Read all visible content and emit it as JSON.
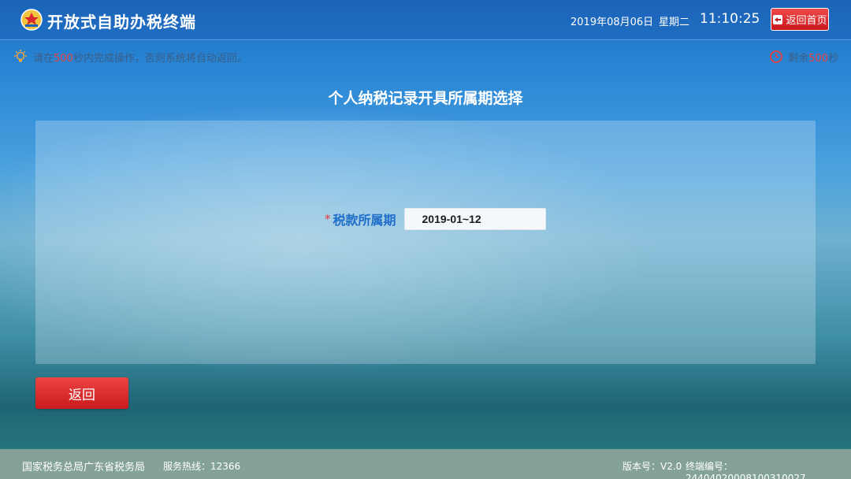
{
  "header": {
    "app_title": "开放式自助办税终端",
    "date": "2019年08月06日",
    "weekday": "星期二",
    "time": "11:10:25",
    "home_label": "返回首页"
  },
  "notice": {
    "prefix": "请在",
    "seconds": "500",
    "suffix": "秒内完成操作，否则系统将自动返回。"
  },
  "timer": {
    "prefix": "剩余",
    "seconds": "500",
    "suffix": "秒"
  },
  "page": {
    "title": "个人纳税记录开具所属期选择"
  },
  "form": {
    "required_mark": "*",
    "period_label": "税款所属期",
    "period_value": "2019-01~12"
  },
  "actions": {
    "back_label": "返回"
  },
  "footer": {
    "org": "国家税务总局广东省税务局",
    "hotline": "服务热线：12366",
    "version": "版本号：V2.0",
    "terminal": "终端编号：24404020008100310027"
  },
  "colors": {
    "header_bg": "#1c64b7",
    "accent_red": "#e33b3b",
    "label_blue": "#1f6ec9"
  }
}
